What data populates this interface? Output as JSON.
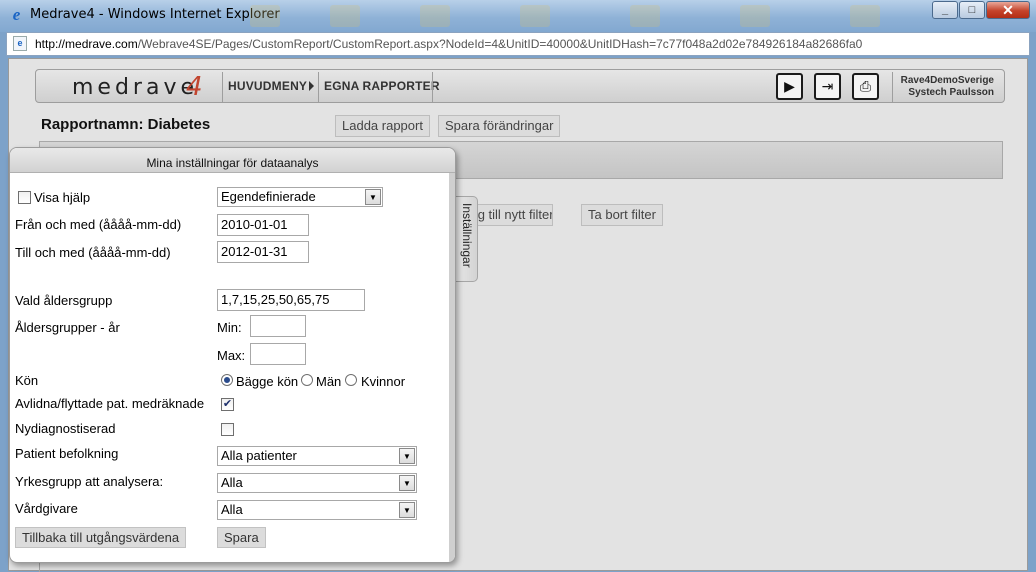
{
  "window": {
    "title": "Medrave4 - Windows Internet Explorer",
    "url_host": "http://medrave.com",
    "url_path": "/Webrave4SE/Pages/CustomReport/CustomReport.aspx?NodeId=4&UnitID=40000&UnitIDHash=7c77f048a2d02e784926184a82686fa0"
  },
  "nav": {
    "logo_text": "medrave",
    "logo_number": "4",
    "main_menu": "HUVUDMENY",
    "custom_reports": "EGNA RAPPORTER",
    "user_line1": "Rave4DemoSverige",
    "user_line2": "Systech Paulsson",
    "icons": [
      "play-icon",
      "export-icon",
      "print-icon"
    ]
  },
  "report": {
    "name": "Rapportnamn: Diabetes",
    "load_button": "Ladda rapport",
    "save_changes_button": "Spara förändringar",
    "add_filter_button": "Lägg till nytt filter",
    "remove_filter_button": "Ta bort filter"
  },
  "settings": {
    "header": "Mina inställningar för dataanalys",
    "side_tab": "Inställningar",
    "show_help_label": "Visa hjälp",
    "show_help_checked": false,
    "period_select": "Egendefinierade",
    "from_label": "Från och med (åååå-mm-dd)",
    "from_value": "2010-01-01",
    "to_label": "Till och med (åååå-mm-dd)",
    "to_value": "2012-01-31",
    "age_group_label": "Vald åldersgrupp",
    "age_group_value": "1,7,15,25,50,65,75",
    "age_groups_years_label": "Åldersgrupper - år",
    "min_label": "Min:",
    "min_value": "",
    "max_label": "Max:",
    "max_value": "",
    "gender_label": "Kön",
    "gender_options": [
      "Bägge kön",
      "Män",
      "Kvinnor"
    ],
    "gender_selected": "Bägge kön",
    "deceased_label": "Avlidna/flyttade pat. medräknade",
    "deceased_checked": true,
    "newly_diagnosed_label": "Nydiagnostiserad",
    "newly_diagnosed_checked": false,
    "patient_population_label": "Patient befolkning",
    "patient_population_value": "Alla patienter",
    "profession_label": "Yrkesgrupp att analysera:",
    "profession_value": "Alla",
    "care_giver_label": "Vårdgivare",
    "care_giver_value": "Alla",
    "reset_button": "Tillbaka till utgångsvärdena",
    "save_button": "Spara"
  }
}
